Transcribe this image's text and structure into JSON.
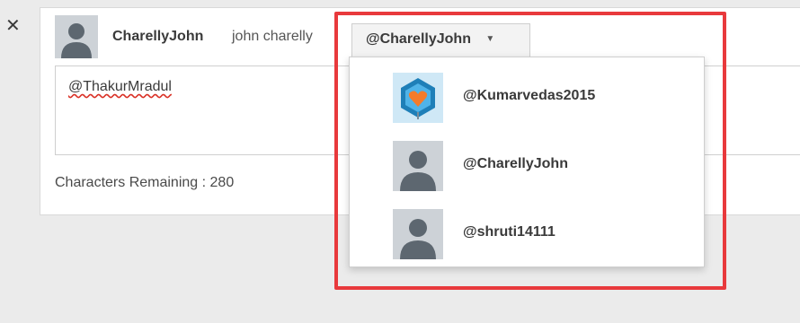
{
  "close": {
    "icon": "close-icon",
    "glyph": "✕"
  },
  "author": {
    "avatar_icon": "default-avatar-icon",
    "username": "CharellyJohn",
    "full_name": "john charelly"
  },
  "handle_select": {
    "selected": "@CharellyJohn",
    "caret_icon": "caret-down-icon"
  },
  "compose": {
    "text": "@ThakurMradul"
  },
  "footer": {
    "chars_remaining": "Characters Remaining : 280"
  },
  "dropdown": {
    "items": [
      {
        "handle": "@Kumarvedas2015",
        "avatar_icon": "heart-brand-avatar-icon"
      },
      {
        "handle": "@CharellyJohn",
        "avatar_icon": "default-avatar-icon"
      },
      {
        "handle": "@shruti14111",
        "avatar_icon": "default-avatar-icon"
      }
    ]
  },
  "annotation": {
    "color": "#e8393c"
  }
}
